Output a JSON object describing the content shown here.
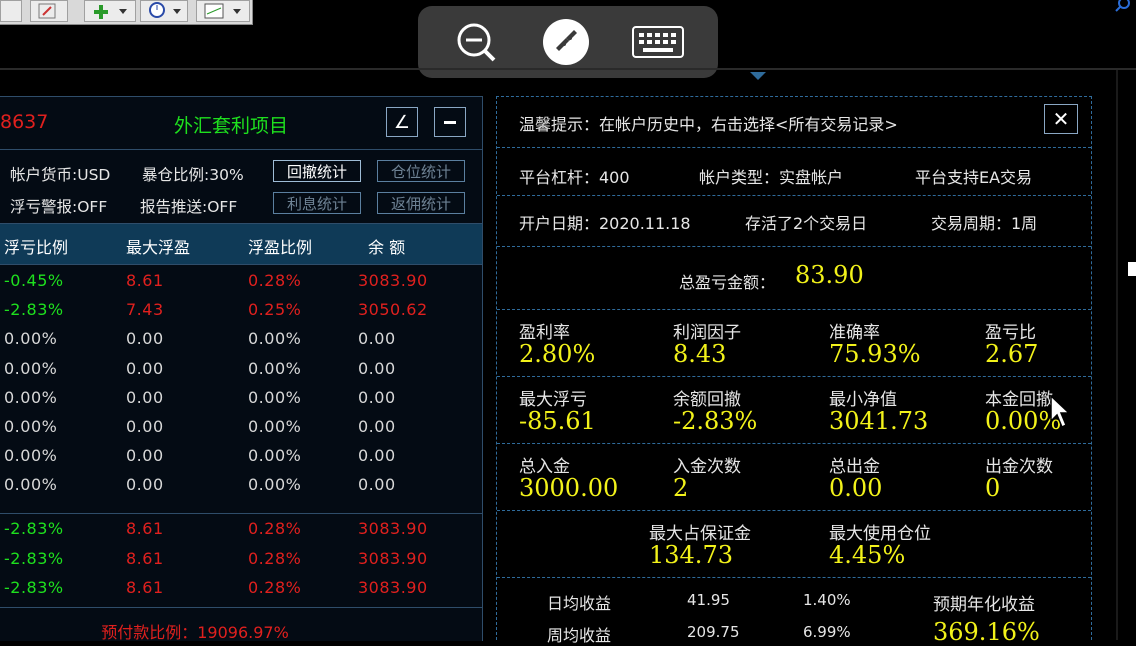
{
  "remote_toolbar": {
    "zoom_out": "zoom-out",
    "connect": "remote-connection",
    "keyboard": "keyboard"
  },
  "left_panel": {
    "account_fragment": "8637",
    "title": "外汇套利项目",
    "info": {
      "currency": "帐户货币:USD",
      "exposure": "暴仓比例:30%",
      "float_alert": "浮亏警报:OFF",
      "report_push": "报告推送:OFF"
    },
    "buttons": {
      "drawdown_stats": "回撤统计",
      "position_stats": "仓位统计",
      "interest_stats": "利息统计",
      "rebate_stats": "返佣统计"
    },
    "columns": [
      "浮亏比例",
      "最大浮盈",
      "浮盈比例",
      "余 额"
    ],
    "rows": [
      [
        "-0.45%",
        "8.61",
        "0.28%",
        "3083.90"
      ],
      [
        "-2.83%",
        "7.43",
        "0.25%",
        "3050.62"
      ],
      [
        "0.00%",
        "0.00",
        "0.00%",
        "0.00"
      ],
      [
        "0.00%",
        "0.00",
        "0.00%",
        "0.00"
      ],
      [
        "0.00%",
        "0.00",
        "0.00%",
        "0.00"
      ],
      [
        "0.00%",
        "0.00",
        "0.00%",
        "0.00"
      ],
      [
        "0.00%",
        "0.00",
        "0.00%",
        "0.00"
      ],
      [
        "0.00%",
        "0.00",
        "0.00%",
        "0.00"
      ]
    ],
    "summary_rows": [
      [
        "-2.83%",
        "8.61",
        "0.28%",
        "3083.90"
      ],
      [
        "-2.83%",
        "8.61",
        "0.28%",
        "3083.90"
      ],
      [
        "-2.83%",
        "8.61",
        "0.28%",
        "3083.90"
      ]
    ],
    "prepay": "预付款比例：19096.97%"
  },
  "right_panel": {
    "tip": "温馨提示：在帐户历史中，右击选择<所有交易记录>",
    "leverage": "平台杠杆：400",
    "account_type": "帐户类型：实盘帐户",
    "ea_support": "平台支持EA交易",
    "open_date": "开户日期：2020.11.18",
    "alive_days": "存活了2个交易日",
    "trade_period": "交易周期：1周",
    "total_pl_label": "总盈亏金额：",
    "total_pl_value": "83.90",
    "metrics": [
      {
        "label": "盈利率",
        "value": "2.80%"
      },
      {
        "label": "利润因子",
        "value": "8.43"
      },
      {
        "label": "准确率",
        "value": "75.93%"
      },
      {
        "label": "盈亏比",
        "value": "2.67"
      },
      {
        "label": "最大浮亏",
        "value": "-85.61"
      },
      {
        "label": "余额回撤",
        "value": "-2.83%"
      },
      {
        "label": "最小净值",
        "value": "3041.73"
      },
      {
        "label": "本金回撤",
        "value": "0.00%"
      },
      {
        "label": "总入金",
        "value": "3000.00"
      },
      {
        "label": "入金次数",
        "value": "2"
      },
      {
        "label": "总出金",
        "value": "0.00"
      },
      {
        "label": "出金次数",
        "value": "0"
      }
    ],
    "margin_label": "最大占保证金",
    "margin_value": "134.73",
    "max_pos_label": "最大使用仓位",
    "max_pos_value": "4.45%",
    "daily_label": "日均收益",
    "daily_amount": "41.95",
    "daily_pct": "1.40%",
    "weekly_label": "周均收益",
    "weekly_amount": "209.75",
    "weekly_pct": "6.99%",
    "annual_label": "预期年化收益",
    "annual_value": "369.16%"
  }
}
